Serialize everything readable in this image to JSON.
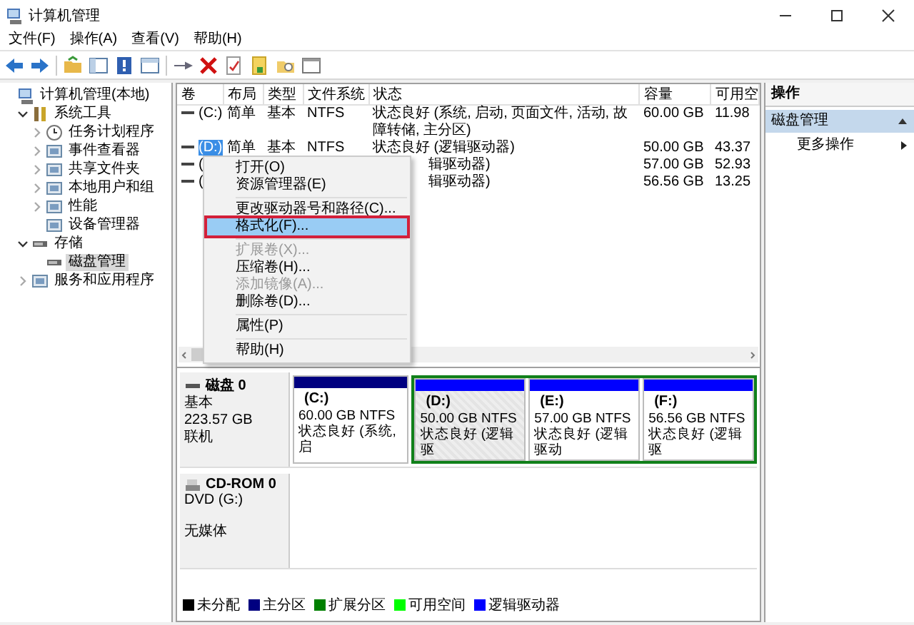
{
  "window": {
    "title": "计算机管理"
  },
  "menu_bar": [
    "文件(F)",
    "操作(A)",
    "查看(V)",
    "帮助(H)"
  ],
  "tree": [
    {
      "label": "计算机管理(本地)",
      "selected": false,
      "children": [
        {
          "label": "系统工具",
          "expanded": true,
          "selected": false,
          "children": [
            {
              "label": "任务计划程序",
              "expanded": false,
              "selected": false
            },
            {
              "label": "事件查看器",
              "expanded": false,
              "selected": false
            },
            {
              "label": "共享文件夹",
              "expanded": false,
              "selected": false
            },
            {
              "label": "本地用户和组",
              "expanded": false,
              "selected": false
            },
            {
              "label": "性能",
              "expanded": false,
              "selected": false
            },
            {
              "label": "设备管理器",
              "selected": false
            }
          ]
        },
        {
          "label": "存储",
          "expanded": true,
          "selected": false,
          "children": [
            {
              "label": "磁盘管理",
              "selected": true
            }
          ]
        },
        {
          "label": "服务和应用程序",
          "expanded": false,
          "selected": false
        }
      ]
    }
  ],
  "table": {
    "columns": [
      "卷",
      "布局",
      "类型",
      "文件系统",
      "状态",
      "容量",
      "可用空"
    ],
    "rows": [
      {
        "volume": "(C:)",
        "layout": "简单",
        "type": "基本",
        "fs": "NTFS",
        "status": "状态良好 (系统, 启动, 页面文件, 活动, 故障转储, 主分区)",
        "capacity": "60.00 GB",
        "free": "11.98",
        "selected": false,
        "covered": false
      },
      {
        "volume": "(D:)",
        "layout": "简单",
        "type": "基本",
        "fs": "NTFS",
        "status": "状态良好 (逻辑驱动器)",
        "capacity": "50.00 GB",
        "free": "43.37",
        "selected": true,
        "covered": false
      },
      {
        "volume": "(",
        "status": "辑驱动器)",
        "capacity": "57.00 GB",
        "free": "52.93",
        "selected": false,
        "covered": true
      },
      {
        "volume": "(",
        "status": "辑驱动器)",
        "capacity": "56.56 GB",
        "free": "13.25",
        "selected": false,
        "covered": true
      }
    ]
  },
  "context_menu": {
    "items": [
      {
        "kind": "item",
        "label": "打开(O)",
        "disabled": false,
        "selected": false,
        "marked": false
      },
      {
        "kind": "item",
        "label": "资源管理器(E)",
        "disabled": false,
        "selected": false,
        "marked": false
      },
      {
        "kind": "separator"
      },
      {
        "kind": "item",
        "label": "更改驱动器号和路径(C)...",
        "disabled": false,
        "selected": false,
        "marked": false
      },
      {
        "kind": "item",
        "label": "格式化(F)...",
        "disabled": false,
        "selected": true,
        "marked": true
      },
      {
        "kind": "separator"
      },
      {
        "kind": "item",
        "label": "扩展卷(X)...",
        "disabled": true,
        "selected": false,
        "marked": false
      },
      {
        "kind": "item",
        "label": "压缩卷(H)...",
        "disabled": false,
        "selected": false,
        "marked": false
      },
      {
        "kind": "item",
        "label": "添加镜像(A)...",
        "disabled": true,
        "selected": false,
        "marked": false
      },
      {
        "kind": "item",
        "label": "删除卷(D)...",
        "disabled": false,
        "selected": false,
        "marked": false
      },
      {
        "kind": "separator"
      },
      {
        "kind": "item",
        "label": "属性(P)",
        "disabled": false,
        "selected": false,
        "marked": false
      },
      {
        "kind": "separator"
      },
      {
        "kind": "item",
        "label": "帮助(H)",
        "disabled": false,
        "selected": false,
        "marked": false
      }
    ]
  },
  "disks": [
    {
      "kind": "disk",
      "name": "磁盘 0",
      "lines": [
        "基本",
        "223.57 GB",
        "联机"
      ],
      "partitions": [
        {
          "kind": "primary",
          "label": "(C:)",
          "size": "60.00 GB NTFS",
          "status": "状态良好 (系统, 启",
          "selected": false
        },
        {
          "kind": "extended",
          "children": [
            {
              "kind": "logical",
              "label": "(D:)",
              "size": "50.00 GB NTFS",
              "status": "状态良好 (逻辑驱",
              "selected": true
            },
            {
              "kind": "logical",
              "label": "(E:)",
              "size": "57.00 GB NTFS",
              "status": "状态良好 (逻辑驱动",
              "selected": false
            },
            {
              "kind": "logical",
              "label": "(F:)",
              "size": "56.56 GB NTFS",
              "status": "状态良好 (逻辑驱",
              "selected": false
            }
          ]
        }
      ]
    },
    {
      "kind": "cdrom",
      "name": "CD-ROM 0",
      "lines": [
        "DVD (G:)",
        "无媒体"
      ]
    }
  ],
  "legend": [
    {
      "label": "未分配",
      "color": "#000000"
    },
    {
      "label": "主分区",
      "color": "#000080"
    },
    {
      "label": "扩展分区",
      "color": "#008000"
    },
    {
      "label": "可用空间",
      "color": "#00ff00"
    },
    {
      "label": "逻辑驱动器",
      "color": "#0000ff"
    }
  ],
  "actions": {
    "title": "操作",
    "groups": [
      {
        "label": "磁盘管理",
        "expanded": true,
        "items": [
          "更多操作"
        ]
      }
    ]
  }
}
